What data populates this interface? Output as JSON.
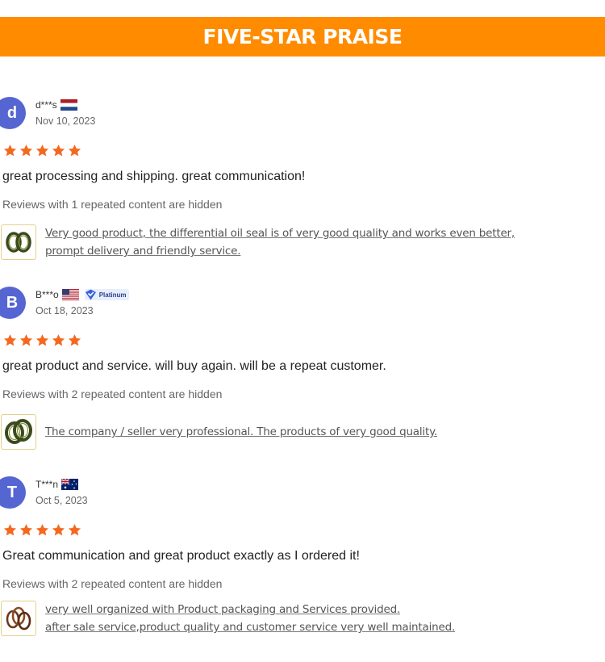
{
  "header": {
    "title": "FIVE-STAR PRAISE"
  },
  "colors": {
    "accent": "#ff8c00",
    "star": "#f4681f",
    "avatar": "#5566d3"
  },
  "reviews": [
    {
      "avatar_letter": "d",
      "username": "d***s",
      "flag": "flag-netherlands",
      "date": "Nov 10, 2023",
      "rating": 5,
      "comment": "great processing and shipping. great communication!",
      "hidden_note": "Reviews with 1 repeated content are hidden",
      "product_icon": "oil-seal-icon",
      "related_lines": [
        "Very good product, the differential oil seal is of very good quality and works even better,",
        "prompt delivery and friendly service."
      ]
    },
    {
      "avatar_letter": "B",
      "username": "B***o",
      "flag": "flag-usa",
      "badge": "Platinum",
      "date": "Oct 18, 2023",
      "rating": 5,
      "comment": "great product and service. will buy again. will be a repeat customer.",
      "hidden_note": "Reviews with 2 repeated content are hidden",
      "product_icon": "oil-seal-icon",
      "related_lines": [
        "The company / seller very professional. The products of very good quality."
      ]
    },
    {
      "avatar_letter": "T",
      "username": "T***n",
      "flag": "flag-australia",
      "date": "Oct 5, 2023",
      "rating": 5,
      "comment": "Great communication and great product exactly as I ordered it!",
      "hidden_note": "Reviews with 2 repeated content are hidden",
      "product_icon": "o-ring-icon",
      "related_lines": [
        "very well organized with Product packaging and Services provided.",
        "after sale service,product quality and customer service very well maintained."
      ]
    }
  ]
}
